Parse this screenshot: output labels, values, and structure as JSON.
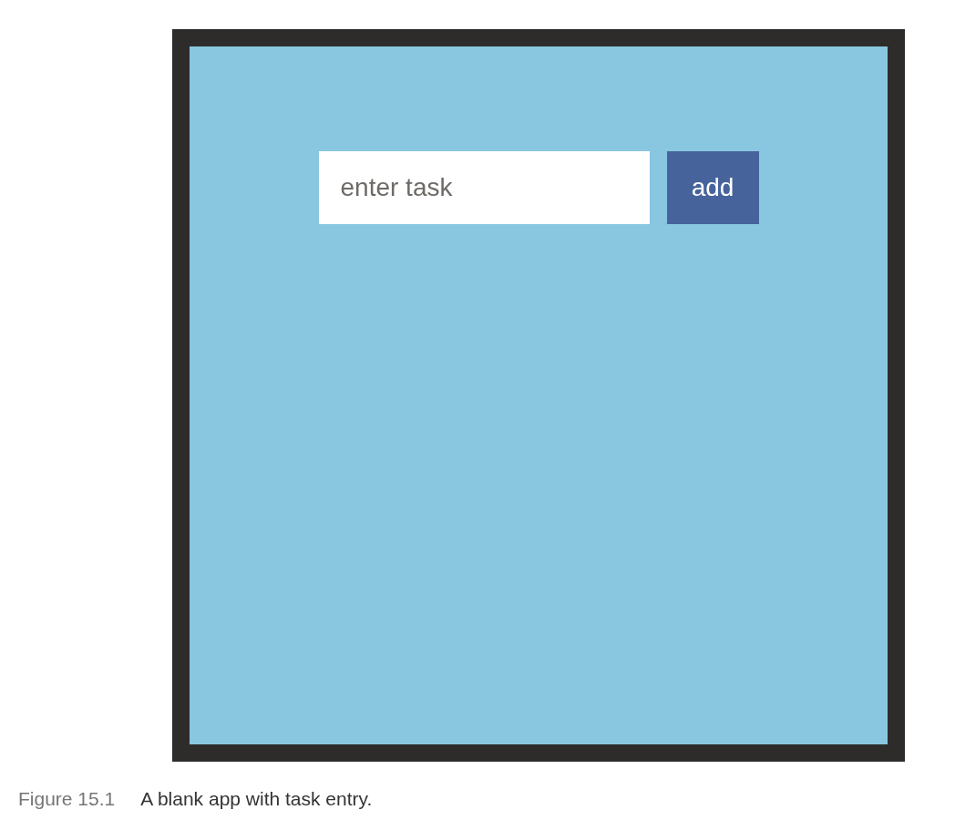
{
  "figure": {
    "app": {
      "task_input": {
        "placeholder": "enter task"
      },
      "add_button": {
        "label": "add"
      }
    },
    "caption": {
      "label": "Figure 15.1",
      "text": "A blank app with task entry."
    }
  }
}
